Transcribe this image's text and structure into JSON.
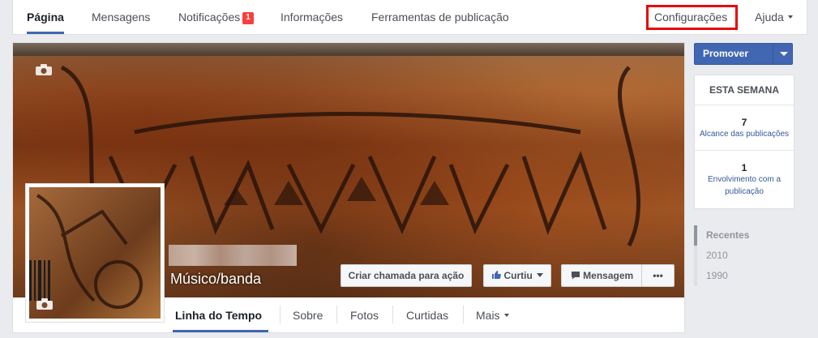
{
  "topnav": {
    "tabs": [
      "Página",
      "Mensagens",
      "Notificações",
      "Informações",
      "Ferramentas de publicação"
    ],
    "notifications_badge": "1",
    "settings": "Configurações",
    "help": "Ajuda"
  },
  "cover": {
    "category": "Músico/banda",
    "buttons": {
      "cta": "Criar chamada para ação",
      "liked": "Curtiu",
      "message": "Mensagem",
      "more": "•••"
    }
  },
  "subnav": {
    "tabs": [
      "Linha do Tempo",
      "Sobre",
      "Fotos",
      "Curtidas",
      "Mais"
    ]
  },
  "sidebar": {
    "promote": "Promover",
    "week_title": "ESTA SEMANA",
    "stats": [
      {
        "value": "7",
        "label": "Alcance das publicações"
      },
      {
        "value": "1",
        "label": "Envolvimento com a publicação"
      }
    ],
    "timeline": [
      "Recentes",
      "2010",
      "1990"
    ]
  },
  "colors": {
    "accent": "#4267b2",
    "badge": "#fa3e3e",
    "highlight": "#e8060a"
  }
}
